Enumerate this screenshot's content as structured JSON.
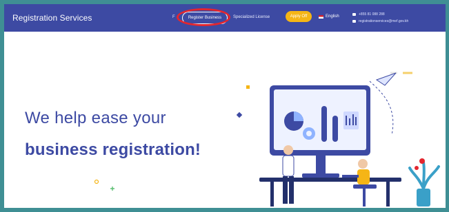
{
  "header": {
    "brand": "Registration Services",
    "nav": {
      "short_item": "F",
      "register_business": "Register Business",
      "specialized_license": "Specialized License",
      "apply_button": "Apply Off",
      "language": "English"
    },
    "contact": {
      "phone": "+855 81 088 288",
      "email": "registrationservices@mef.gov.kh"
    }
  },
  "hero": {
    "line1": "We help ease your",
    "line2": "business registration!"
  },
  "colors": {
    "navbar": "#3d4aa3",
    "accent": "#f5b516",
    "highlight_circle": "#e3262f",
    "outer_border": "#3f8f94"
  },
  "icons": [
    "phone-icon",
    "email-icon",
    "flag-icon"
  ]
}
